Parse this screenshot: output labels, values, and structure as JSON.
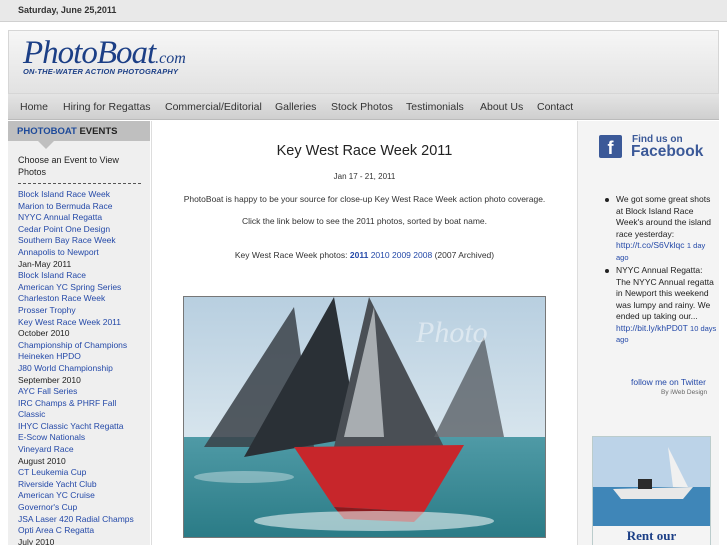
{
  "date": "Saturday, June 25,2011",
  "logo": {
    "main": "PhotoBoat",
    "suffix": ".com",
    "tagline": "ON-THE-WATER ACTION PHOTOGRAPHY"
  },
  "nav": [
    "Home",
    "Hiring for Regattas",
    "Commercial/Editorial",
    "Galleries",
    "Stock Photos",
    "Testimonials",
    "About Us",
    "Contact"
  ],
  "sidebar": {
    "title_brand": "PHOTOBOAT",
    "title_rest": "EVENTS",
    "intro": "Choose an Event to View Photos",
    "items": [
      {
        "text": "Block Island Race Week",
        "link": true
      },
      {
        "text": "Marion to Bermuda Race",
        "link": true
      },
      {
        "text": "NYYC Annual Regatta",
        "link": true
      },
      {
        "text": "Cedar Point One Design",
        "link": true
      },
      {
        "text": "Southern Bay Race Week",
        "link": true
      },
      {
        "text": "Annapolis to Newport",
        "link": true
      },
      {
        "text": "Jan-May 2011",
        "link": false
      },
      {
        "text": "Block Island Race",
        "link": true
      },
      {
        "text": "American YC Spring Series",
        "link": true
      },
      {
        "text": "Charleston Race Week",
        "link": true
      },
      {
        "text": "Prosser Trophy",
        "link": true
      },
      {
        "text": "Key West Race Week 2011",
        "link": true
      },
      {
        "text": "October 2010",
        "link": false
      },
      {
        "text": "Championship of Champions",
        "link": true
      },
      {
        "text": "Heineken HPDO",
        "link": true
      },
      {
        "text": "J80 World Championship",
        "link": true
      },
      {
        "text": "September 2010",
        "link": false
      },
      {
        "text": "AYC Fall Series",
        "link": true
      },
      {
        "text": "IRC Champs & PHRF Fall",
        "link": true
      },
      {
        "text": "Classic",
        "link": true
      },
      {
        "text": "IHYC Classic Yacht Regatta",
        "link": true
      },
      {
        "text": "E-Scow Nationals",
        "link": true
      },
      {
        "text": "Vineyard Race",
        "link": true
      },
      {
        "text": "August 2010",
        "link": false
      },
      {
        "text": "CT Leukemia Cup",
        "link": true
      },
      {
        "text": "Riverside Yacht Club",
        "link": true
      },
      {
        "text": "American YC Cruise",
        "link": true
      },
      {
        "text": "Governor's Cup",
        "link": true
      },
      {
        "text": "JSA Laser 420 Radial Champs",
        "link": true
      },
      {
        "text": "Opti Area C Regatta",
        "link": true
      },
      {
        "text": "July 2010",
        "link": false
      }
    ]
  },
  "content": {
    "title": "Key West Race Week 2011",
    "dates": "Jan 17 - 21, 2011",
    "intro": "PhotoBoat is happy to be your source for close-up Key West Race Week action photo coverage.",
    "instruction": "Click the link below to see the 2011 photos, sorted by boat name.",
    "photos_label": "Key West Race Week photos:",
    "years": [
      "2011",
      "2010",
      "2009",
      "2008"
    ],
    "archived": "(2007 Archived)",
    "photo_watermark": "Photo"
  },
  "rightbar": {
    "fb_find": "Find us on",
    "fb_name": "Facebook",
    "tweets": [
      {
        "text": "We got some great shots at Block Island Race Week's around the island race yesterday:",
        "link": "http://t.co/S6Vklqc",
        "ago": "1 day ago"
      },
      {
        "text": "NYYC Annual Regatta: The NYYC Annual regatta in Newport this weekend was lumpy and rainy. We ended up taking our...",
        "link": "http://bit.ly/khPD0T",
        "ago": "10 days ago"
      }
    ],
    "follow": "follow me on Twitter",
    "byline": "By iWeb Design",
    "promo": "Rent our"
  }
}
